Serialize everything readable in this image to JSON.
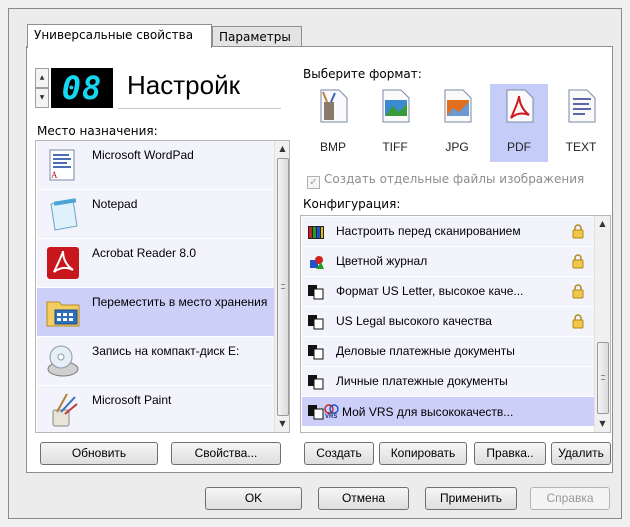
{
  "tabs": [
    "Универсальные свойства",
    "Параметры"
  ],
  "profile": {
    "number": "08",
    "name": "Настройк"
  },
  "destination": {
    "label": "Место назначения:",
    "items": [
      {
        "label": "Microsoft WordPad",
        "icon": "wordpad-icon"
      },
      {
        "label": "Notepad",
        "icon": "notepad-icon"
      },
      {
        "label": "Acrobat Reader 8.0",
        "icon": "acrobat-icon"
      },
      {
        "label": "Переместить в место хранения",
        "icon": "folder-icon",
        "selected": true
      },
      {
        "label": "Запись на компакт-диск E:",
        "icon": "cd-burn-icon"
      },
      {
        "label": "Microsoft Paint",
        "icon": "paint-icon"
      }
    ]
  },
  "format": {
    "label": "Выберите формат:",
    "items": [
      {
        "label": "BMP",
        "icon": "bmp-icon"
      },
      {
        "label": "TIFF",
        "icon": "tiff-icon"
      },
      {
        "label": "JPG",
        "icon": "jpg-icon"
      },
      {
        "label": "PDF",
        "icon": "pdf-icon",
        "selected": true
      },
      {
        "label": "TEXT",
        "icon": "text-icon"
      }
    ],
    "checkbox_label": "Создать отдельные файлы изображения",
    "checkbox_checked": true
  },
  "config": {
    "label": "Конфигурация:",
    "items": [
      {
        "label": "Настроить перед сканированием",
        "locked": true
      },
      {
        "label": "Цветной журнал",
        "locked": true
      },
      {
        "label": "Формат US Letter, высокое каче...",
        "locked": true
      },
      {
        "label": "US Legal высокого качества",
        "locked": true
      },
      {
        "label": "Деловые платежные документы",
        "locked": false
      },
      {
        "label": "Личные платежные документы",
        "locked": false
      },
      {
        "label": "Мой VRS для высококачеств...",
        "locked": false,
        "selected": true
      }
    ]
  },
  "buttons": {
    "refresh": "Обновить",
    "properties": "Свойства...",
    "create": "Создать",
    "copy": "Копировать",
    "edit": "Правка..",
    "delete": "Удалить",
    "ok": "OK",
    "cancel": "Отмена",
    "apply": "Применить",
    "help": "Справка"
  },
  "colors": {
    "selection": "#ccd0f8",
    "item_bg": "#f3f3fc",
    "digit": "#15d7f0"
  }
}
